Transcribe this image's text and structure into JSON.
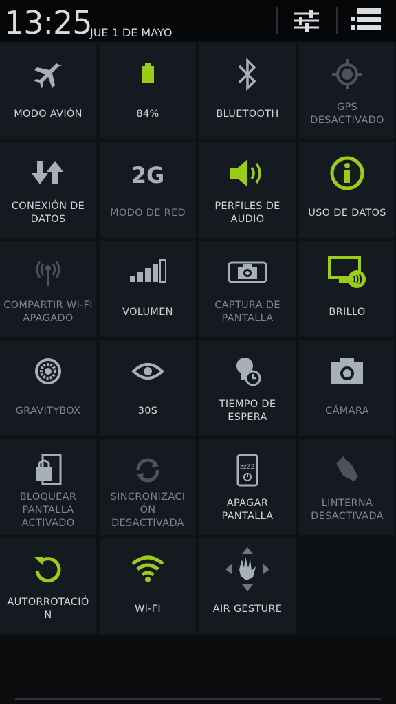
{
  "status": {
    "time": "13:25",
    "date": "JUE 1 DE MAYO"
  },
  "header": {
    "settings_icon": "sliders-icon",
    "list_icon": "list-icon"
  },
  "colors": {
    "accent_green": "#9ccc1a",
    "icon_gray": "#a7b0b5",
    "icon_dim": "#4c5459",
    "tile_bg": "#141a1f"
  },
  "tiles": [
    {
      "label": "MODO AVIÓN",
      "icon": "airplane-icon",
      "state": "gray"
    },
    {
      "label": "84%",
      "icon": "battery-icon",
      "state": "green"
    },
    {
      "label": "BLUETOOTH",
      "icon": "bluetooth-icon",
      "state": "gray"
    },
    {
      "label": "GPS DESACTIVADO",
      "icon": "gps-icon",
      "state": "dim"
    },
    {
      "label": "CONEXIÓN DE DATOS",
      "icon": "data-arrows-icon",
      "state": "gray"
    },
    {
      "label": "MODO DE RED",
      "icon": "network-2g-icon",
      "state": "gray",
      "sub": "2G"
    },
    {
      "label": "PERFILES DE AUDIO",
      "icon": "speaker-icon",
      "state": "green"
    },
    {
      "label": "USO DE DATOS",
      "icon": "info-icon",
      "state": "green"
    },
    {
      "label": "COMPARTIR WI-FI APAGADO",
      "icon": "hotspot-icon",
      "state": "dim"
    },
    {
      "label": "VOLUMEN",
      "icon": "volume-bars-icon",
      "state": "gray"
    },
    {
      "label": "CAPTURA DE PANTALLA",
      "icon": "screenshot-icon",
      "state": "gray"
    },
    {
      "label": "BRILLO",
      "icon": "brightness-icon",
      "state": "green"
    },
    {
      "label": "GRAVITYBOX",
      "icon": "gear-icon",
      "state": "gray"
    },
    {
      "label": "30S",
      "icon": "eye-icon",
      "state": "gray"
    },
    {
      "label": "TIEMPO DE ESPERA",
      "icon": "bulb-clock-icon",
      "state": "gray"
    },
    {
      "label": "CÁMARA",
      "icon": "camera-icon",
      "state": "gray"
    },
    {
      "label": "BLOQUEAR PANTALLA ACTIVADO",
      "icon": "lock-screen-icon",
      "state": "gray"
    },
    {
      "label": "SINCRONIZACI ÓN DESACTIVADA",
      "icon": "sync-icon",
      "state": "dim"
    },
    {
      "label": "APAGAR PANTALLA",
      "icon": "screen-off-icon",
      "state": "gray"
    },
    {
      "label": "LINTERNA DESACTIVADA",
      "icon": "flashlight-icon",
      "state": "dim"
    },
    {
      "label": "AUTORROTACIÓ N",
      "icon": "rotate-icon",
      "state": "green"
    },
    {
      "label": "WI-FI",
      "icon": "wifi-icon",
      "state": "green"
    },
    {
      "label": "AIR GESTURE",
      "icon": "air-gesture-icon",
      "state": "gray"
    }
  ]
}
